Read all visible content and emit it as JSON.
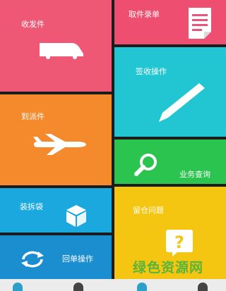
{
  "tiles": {
    "receive": {
      "label": "收发件",
      "icon": "van-icon"
    },
    "pickup": {
      "label": "取件录单",
      "icon": "document-icon"
    },
    "sign": {
      "label": "签收操作",
      "icon": "pen-icon"
    },
    "dispatch": {
      "label": "到派件",
      "icon": "airplane-icon"
    },
    "query": {
      "label": "业务查询",
      "icon": "magnifier-icon"
    },
    "pack": {
      "label": "装拆袋",
      "icon": "box-icon"
    },
    "stuck": {
      "label": "留仓问题",
      "icon": "question-icon"
    },
    "return": {
      "label": "回单操作",
      "icon": "refresh-icon"
    }
  },
  "watermark": {
    "text": "绿色资源网"
  },
  "colors": {
    "receive": "#ef5875",
    "pickup": "#ee4f71",
    "sign": "#22c6d3",
    "dispatch": "#f58a2c",
    "query": "#2bc44f",
    "pack": "#1aa8df",
    "stuck": "#f5c611",
    "return": "#1b8ed0"
  }
}
